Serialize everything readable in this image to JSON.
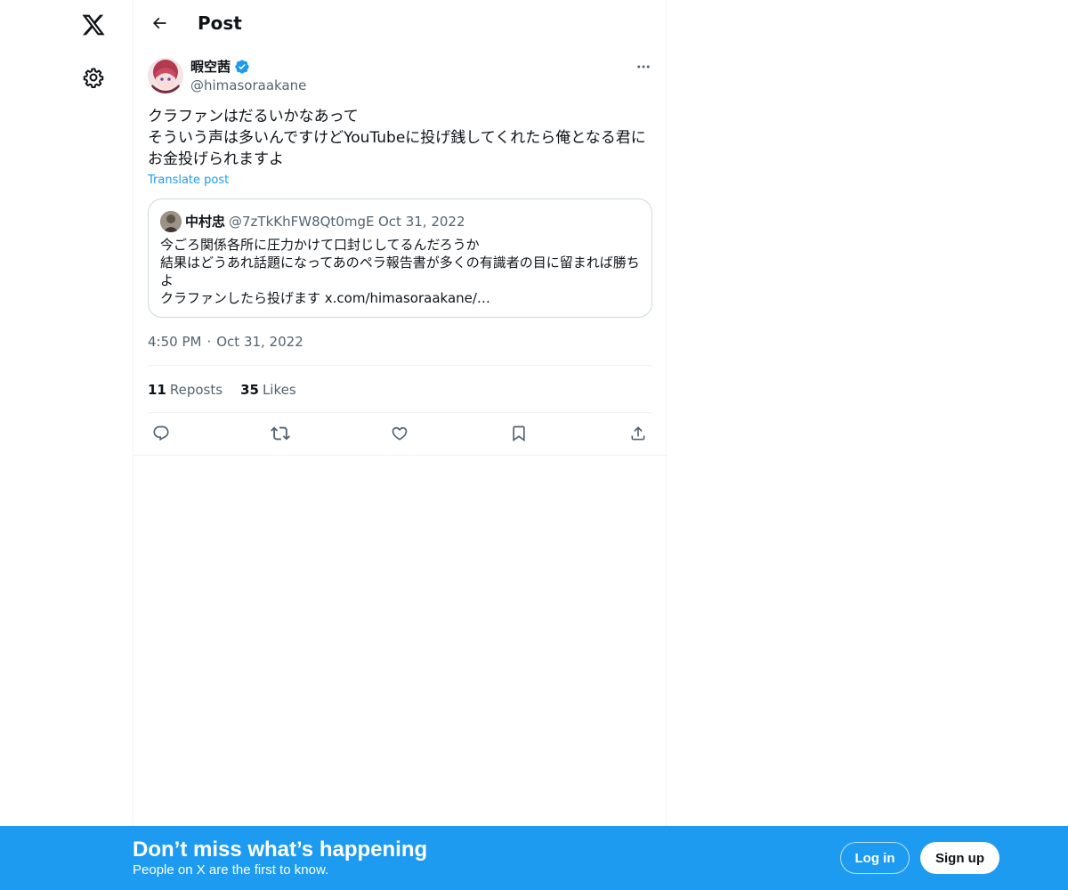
{
  "nav": {
    "logo_icon": "x-logo-icon",
    "settings_icon": "gear-icon"
  },
  "header": {
    "title": "Post",
    "back_icon": "arrow-left-icon"
  },
  "post": {
    "author_name": "暇空茜",
    "author_handle": "@himasoraakane",
    "verified": true,
    "text": "クラファンはだるいかなあって\nそういう声は多いんですけどYouTubeに投げ銭してくれたら俺となる君に\nお金投げられますよ",
    "translate_label": "Translate post",
    "time": "4:50 PM",
    "date": "Oct 31, 2022",
    "separator": "·"
  },
  "quote": {
    "author_name": "中村忠",
    "author_handle": "@7zTkKhFW8Qt0mgE",
    "separator": "·",
    "date": "Oct 31, 2022",
    "text": "今ごろ関係各所に圧力かけて口封じしてるんだろうか\n結果はどうあれ話題になってあのペラ報告書が多くの有識者の目に留まれば勝ち\nよ\nクラファンしたら投げます x.com/himasoraakane/…"
  },
  "stats": {
    "reposts_count": "11",
    "reposts_label": "Reposts",
    "likes_count": "35",
    "likes_label": "Likes"
  },
  "actions": [
    "reply-icon",
    "repost-icon",
    "like-icon",
    "bookmark-icon",
    "share-icon"
  ],
  "banner": {
    "title": "Don’t miss what’s happening",
    "subtitle": "People on X are the first to know.",
    "login_label": "Log in",
    "signup_label": "Sign up"
  },
  "colors": {
    "accent": "#1d9bf0",
    "text": "#0f1419",
    "secondary": "#536471",
    "border": "#eff3f4"
  }
}
